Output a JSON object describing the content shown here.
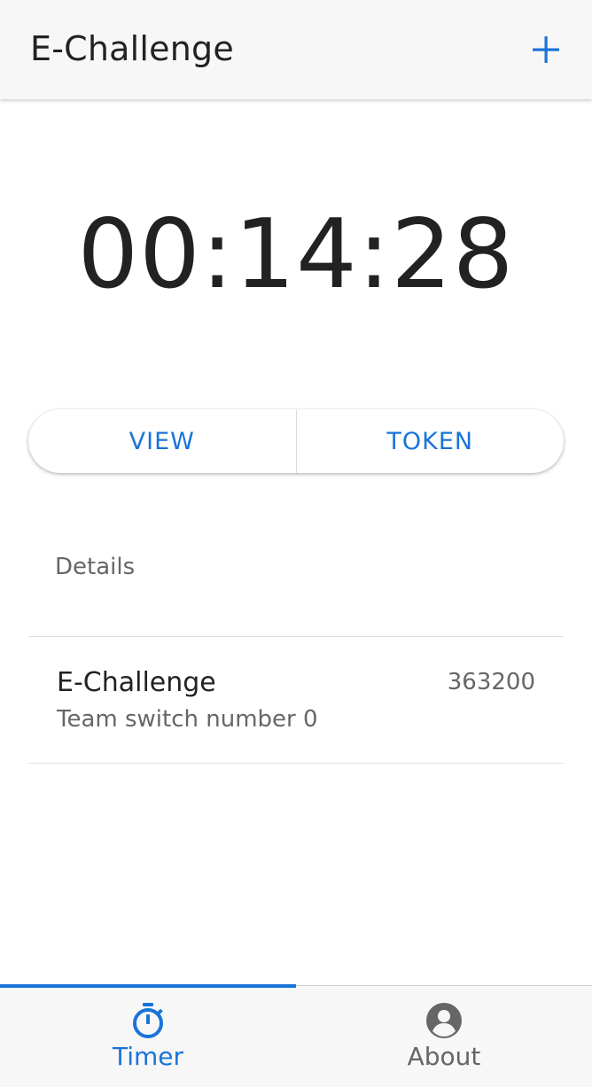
{
  "header": {
    "title": "E-Challenge",
    "add_icon": "plus-icon"
  },
  "timer": {
    "display": "00:14:28"
  },
  "segmented": {
    "view_label": "VIEW",
    "token_label": "TOKEN"
  },
  "details": {
    "section_label": "Details",
    "item": {
      "title": "E-Challenge",
      "subtitle": "Team switch number 0",
      "value": "363200"
    }
  },
  "bottom_nav": {
    "tabs": [
      {
        "label": "Timer",
        "icon": "stopwatch-icon",
        "active": true
      },
      {
        "label": "About",
        "icon": "account-circle-icon",
        "active": false
      }
    ]
  },
  "colors": {
    "accent": "#1a73d9",
    "text_primary": "#222222",
    "text_secondary": "#666666",
    "bar_background": "#f7f7f7"
  }
}
